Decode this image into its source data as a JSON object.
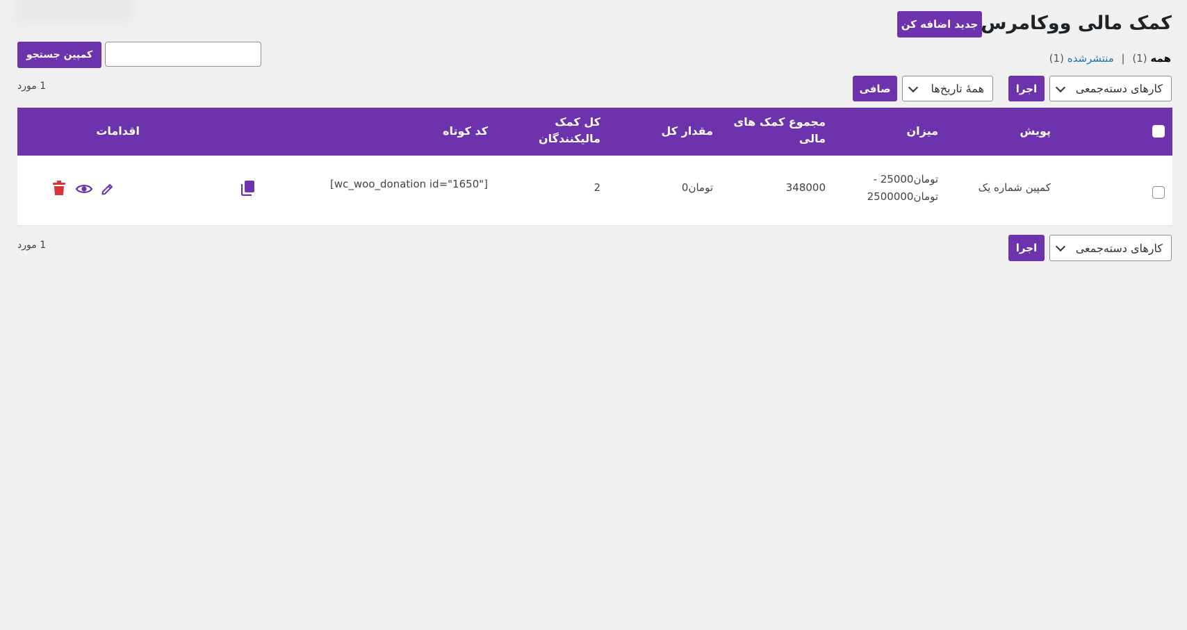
{
  "header": {
    "title": "کمک مالی ووکامرس",
    "add_new_label": "جدید اضافه کن"
  },
  "filters": {
    "all_label": "همه",
    "all_count": "(1)",
    "separator": "|",
    "published_label": "منتشرشده",
    "published_count": "(1)"
  },
  "search": {
    "value": "",
    "button_label": "کمپین جستجو"
  },
  "tablenav_top": {
    "bulk_actions_selected": "کارهای دسته‌جمعی",
    "apply_label": "اجرا",
    "dates_selected": "همهٔ تاریخ‌ها",
    "filter_label": "صافی",
    "items_count": "1 مورد"
  },
  "table": {
    "columns": {
      "campaign": "پویش",
      "amount": "میزان",
      "total_donations_line1": "مجموع کمک های",
      "total_donations_line2": "مالی",
      "total_value": "مقدار کل",
      "total_donors_line1": "کل کمک",
      "total_donors_line2": "مالیکنندگان",
      "shortcode": "کد کوتاه",
      "actions": "اقدامات"
    },
    "rows": [
      {
        "campaign": "کمپین شماره یک",
        "amount_line1": "تومان25000 -",
        "amount_line2": "تومان2500000",
        "total_donations": "348000",
        "total_value": "تومان0",
        "total_donors": "2",
        "shortcode": "[wc_woo_donation id=\"1650\"]"
      }
    ]
  },
  "tablenav_bottom": {
    "bulk_actions_selected": "کارهای دسته‌جمعی",
    "apply_label": "اجرا",
    "items_count": "1 مورد"
  },
  "colors": {
    "accent": "#6c33ad",
    "background": "#f0f0f1",
    "link": "#2271b1",
    "delete": "#d63638"
  },
  "icons": {
    "copy": "copy-icon",
    "edit": "pencil-icon",
    "view": "eye-icon",
    "delete": "trash-icon"
  }
}
